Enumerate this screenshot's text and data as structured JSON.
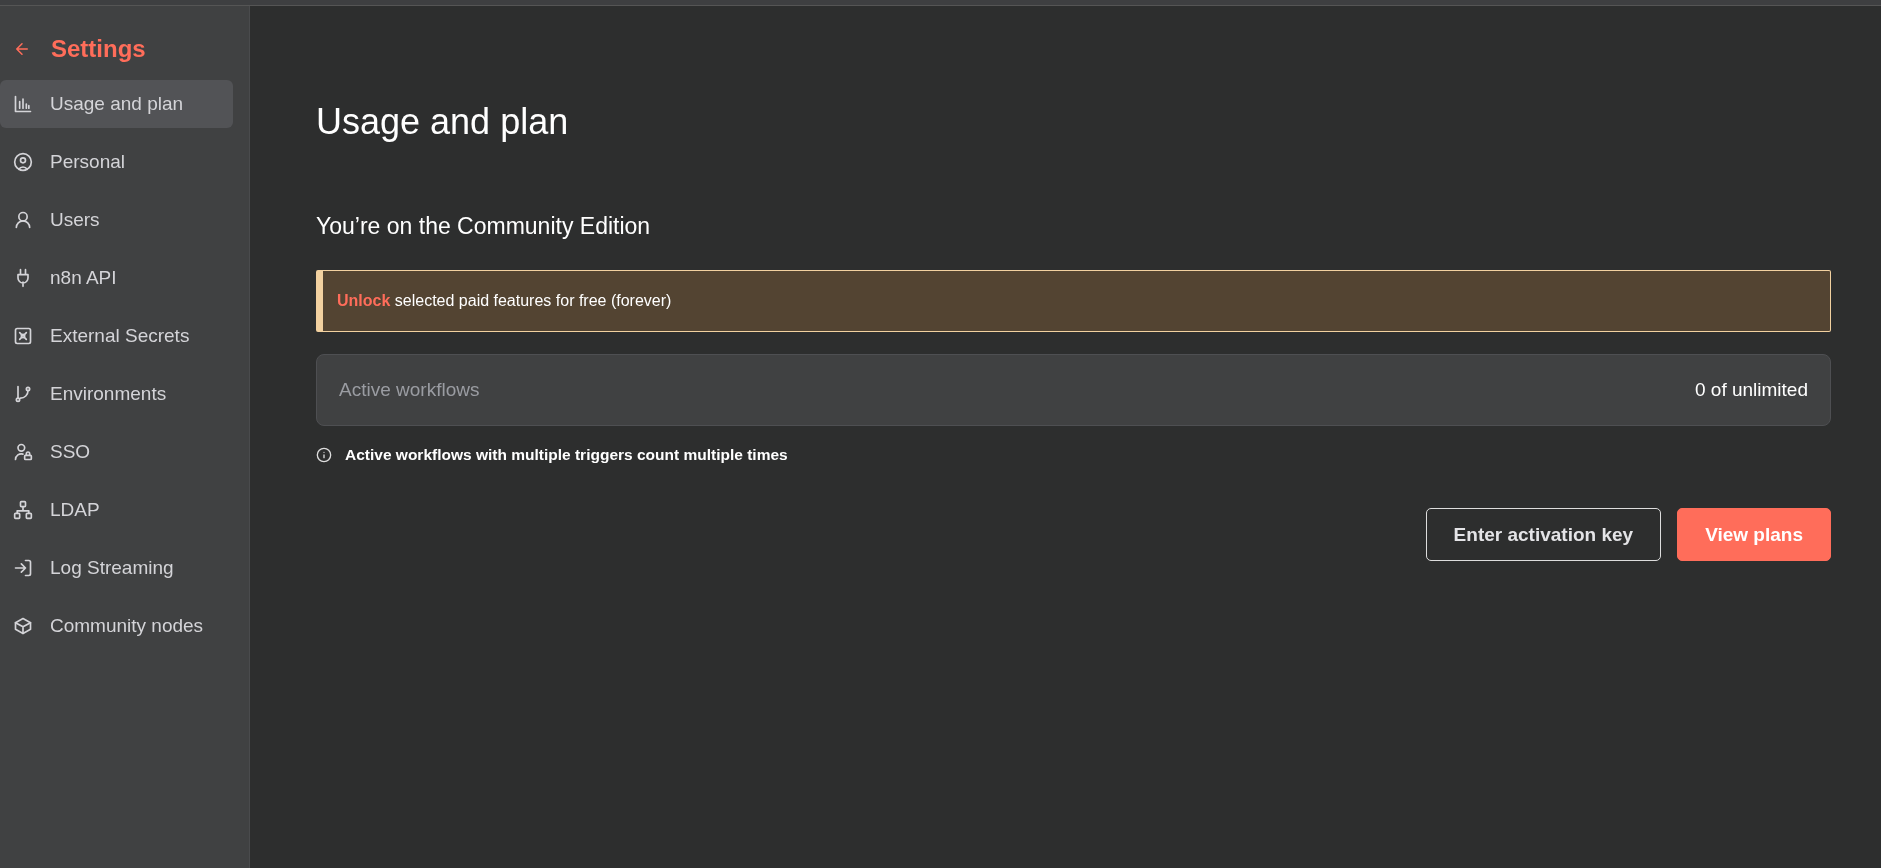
{
  "sidebar": {
    "title": "Settings",
    "items": [
      {
        "label": "Usage and plan",
        "selected": true
      },
      {
        "label": "Personal",
        "selected": false
      },
      {
        "label": "Users",
        "selected": false
      },
      {
        "label": "n8n API",
        "selected": false
      },
      {
        "label": "External Secrets",
        "selected": false
      },
      {
        "label": "Environments",
        "selected": false
      },
      {
        "label": "SSO",
        "selected": false
      },
      {
        "label": "LDAP",
        "selected": false
      },
      {
        "label": "Log Streaming",
        "selected": false
      },
      {
        "label": "Community nodes",
        "selected": false
      }
    ]
  },
  "main": {
    "title": "Usage and plan",
    "subtitle": "You’re on the Community Edition",
    "banner": {
      "link": "Unlock",
      "text": "selected paid features for free (forever)"
    },
    "usage": {
      "label": "Active workflows",
      "value": "0 of unlimited"
    },
    "note": "Active workflows with multiple triggers count multiple times",
    "buttons": [
      {
        "label": "Enter activation key",
        "kind": "secondary"
      },
      {
        "label": "View plans",
        "kind": "primary"
      }
    ]
  }
}
